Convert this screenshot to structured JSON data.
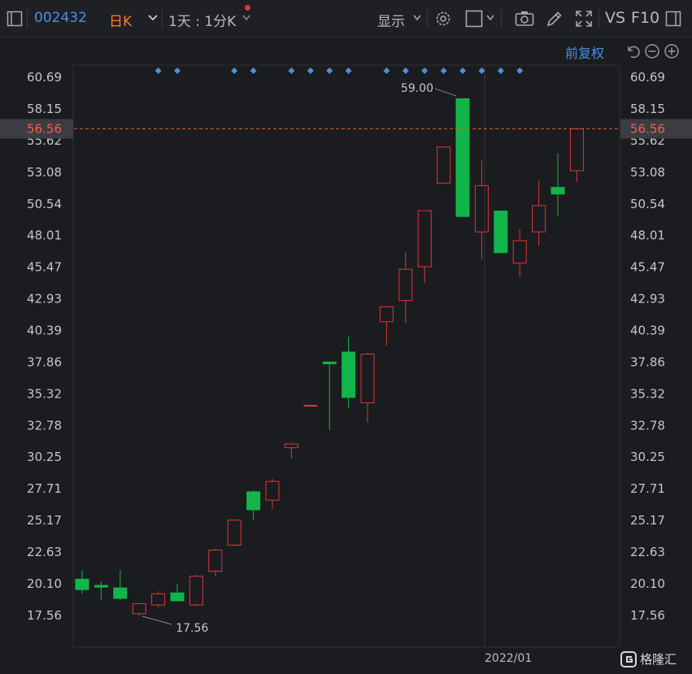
{
  "toolbar": {
    "stock_code": "002432",
    "period": "日K",
    "range": "1天 : 1分K",
    "display": "显示",
    "vs": "VS",
    "f10": "F10"
  },
  "adjust_label": "前复权",
  "brand": "格隆汇",
  "chart_data": {
    "type": "candlestick",
    "y_ticks": [
      "60.69",
      "58.15",
      "55.62",
      "53.08",
      "50.54",
      "48.01",
      "45.47",
      "42.93",
      "40.39",
      "37.86",
      "35.32",
      "32.78",
      "30.25",
      "27.71",
      "25.17",
      "22.63",
      "20.10",
      "17.56"
    ],
    "ylim": [
      17.56,
      60.69
    ],
    "x_label": "2022/01",
    "current_price": "56.56",
    "high_annotation": "59.00",
    "low_annotation": "17.56",
    "colors": {
      "up": "#e0353a",
      "down": "#11b54a",
      "marker": "#4b8fe8",
      "price_line": "#d9652b"
    },
    "marker_indices": [
      4,
      5,
      8,
      9,
      11,
      12,
      13,
      14,
      16,
      17,
      18,
      19,
      20,
      21,
      22,
      23
    ],
    "candles": [
      {
        "o": 20.5,
        "h": 21.2,
        "l": 19.3,
        "c": 19.6
      },
      {
        "o": 20.0,
        "h": 20.3,
        "l": 18.8,
        "c": 19.8
      },
      {
        "o": 19.8,
        "h": 21.2,
        "l": 18.8,
        "c": 18.9
      },
      {
        "o": 17.7,
        "h": 18.6,
        "l": 17.56,
        "c": 18.5
      },
      {
        "o": 18.4,
        "h": 19.5,
        "l": 18.2,
        "c": 19.3
      },
      {
        "o": 19.4,
        "h": 20.1,
        "l": 18.7,
        "c": 18.7
      },
      {
        "o": 18.4,
        "h": 20.8,
        "l": 18.3,
        "c": 20.7
      },
      {
        "o": 21.1,
        "h": 22.9,
        "l": 20.7,
        "c": 22.8
      },
      {
        "o": 23.2,
        "h": 25.3,
        "l": 23.1,
        "c": 25.2
      },
      {
        "o": 27.5,
        "h": 27.6,
        "l": 25.2,
        "c": 26.0
      },
      {
        "o": 26.8,
        "h": 28.5,
        "l": 26.1,
        "c": 28.3
      },
      {
        "o": 31.0,
        "h": 31.4,
        "l": 30.1,
        "c": 31.3
      },
      {
        "o": 34.4,
        "h": 34.4,
        "l": 34.4,
        "c": 34.4
      },
      {
        "o": 37.9,
        "h": 37.9,
        "l": 32.4,
        "c": 37.7
      },
      {
        "o": 38.7,
        "h": 39.9,
        "l": 34.2,
        "c": 35.0
      },
      {
        "o": 34.6,
        "h": 38.6,
        "l": 33.0,
        "c": 38.5
      },
      {
        "o": 41.1,
        "h": 42.4,
        "l": 39.2,
        "c": 42.3
      },
      {
        "o": 42.8,
        "h": 46.7,
        "l": 41.0,
        "c": 45.3
      },
      {
        "o": 45.5,
        "h": 50.0,
        "l": 44.2,
        "c": 50.0
      },
      {
        "o": 52.2,
        "h": 55.1,
        "l": 52.2,
        "c": 55.1
      },
      {
        "o": 59.0,
        "h": 59.0,
        "l": 49.5,
        "c": 49.5
      },
      {
        "o": 48.3,
        "h": 54.0,
        "l": 46.1,
        "c": 52.0
      },
      {
        "o": 50.0,
        "h": 50.0,
        "l": 46.6,
        "c": 46.6
      },
      {
        "o": 45.8,
        "h": 48.5,
        "l": 44.7,
        "c": 47.6
      },
      {
        "o": 48.3,
        "h": 52.4,
        "l": 47.2,
        "c": 50.4
      },
      {
        "o": 51.9,
        "h": 54.6,
        "l": 49.6,
        "c": 51.3
      },
      {
        "o": 53.2,
        "h": 56.56,
        "l": 52.3,
        "c": 56.56
      }
    ]
  }
}
